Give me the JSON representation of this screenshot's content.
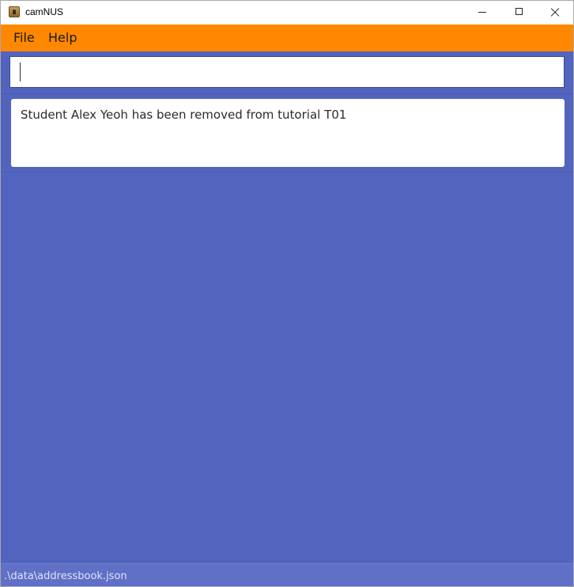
{
  "window": {
    "title": "camNUS",
    "app_icon": "address-book-icon"
  },
  "menu": {
    "items": [
      {
        "label": "File"
      },
      {
        "label": "Help"
      }
    ]
  },
  "command_box": {
    "value": "",
    "placeholder": ""
  },
  "result_display": {
    "text": "Student Alex Yeoh has been removed from tutorial T01"
  },
  "status_bar": {
    "file_path": ".\\data\\addressbook.json"
  },
  "colors": {
    "menu_bar": "#ff8800",
    "background": "#5364bf",
    "status_bar": "#5f70c6"
  }
}
